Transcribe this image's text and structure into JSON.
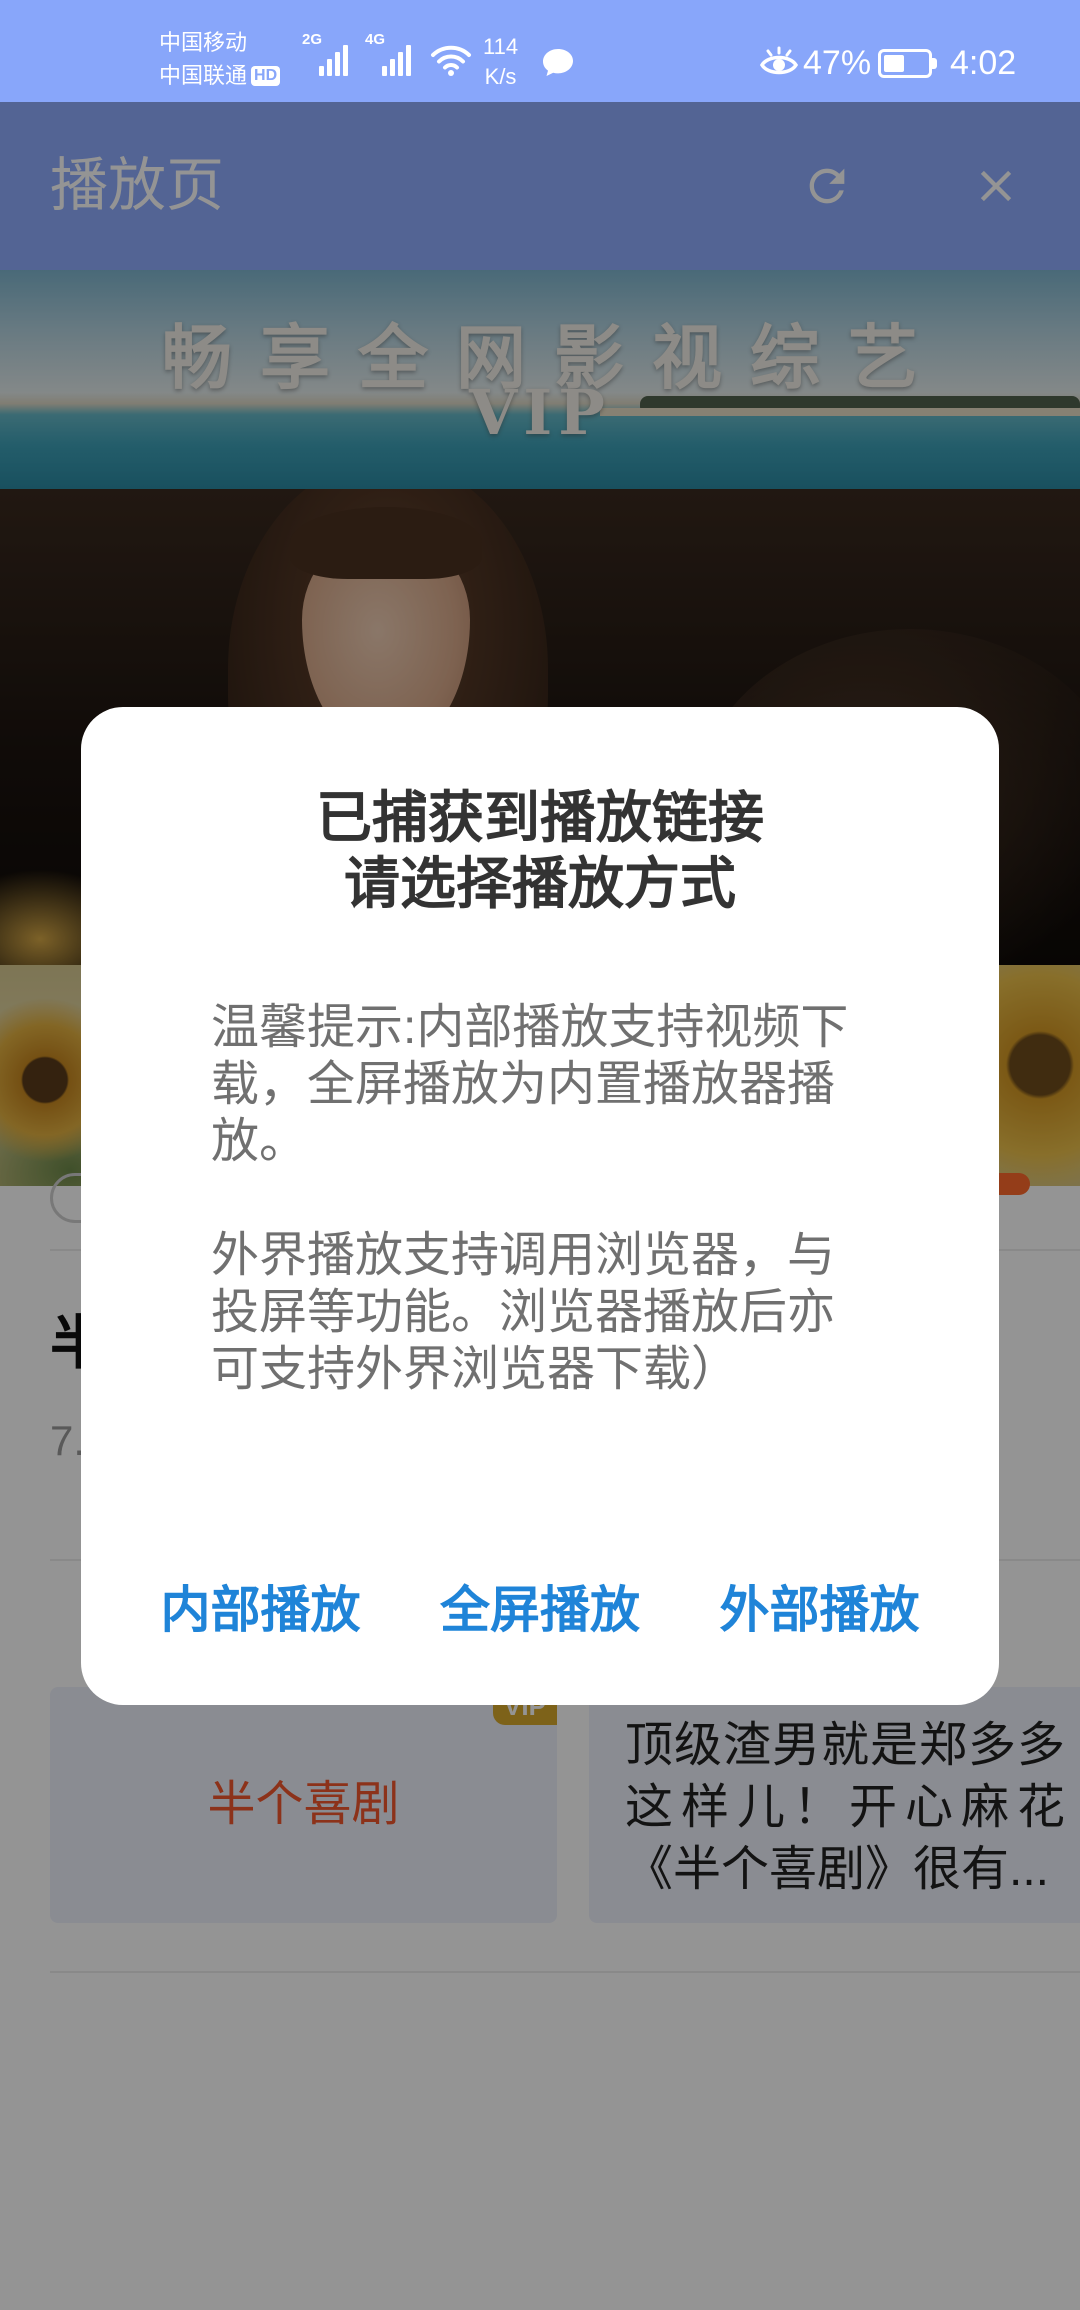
{
  "status_bar": {
    "carrier_primary": "中国移动",
    "carrier_secondary": "中国联通",
    "hd_badge": "HD",
    "network_1": "2G",
    "network_2": "4G",
    "speed_value": "114",
    "speed_unit": "K/s",
    "battery_percent": "47%",
    "battery_level": 0.47,
    "time": "4:02"
  },
  "app_bar": {
    "title": "播放页",
    "icons": {
      "refresh": "refresh-icon",
      "close": "close-icon"
    }
  },
  "banner": {
    "headline": "畅享全网影视综艺",
    "badge": "VIP"
  },
  "content": {
    "title_fragment": "半",
    "meta_fragment": "7.",
    "cards": [
      {
        "title": "半个喜剧",
        "badge": "VIP"
      },
      {
        "description": "顶级渣男就是郑多多这样儿！开心麻花《半个喜剧》很有..."
      }
    ]
  },
  "dialog": {
    "title_lines": [
      "已捕获到播放链接",
      "请选择播放方式"
    ],
    "message_paragraphs": [
      "温馨提示:内部播放支持视频下载，全屏播放为内置播放器播放。",
      "外界播放支持调用浏览器，与投屏等功能。浏览器播放后亦可支持外界浏览器下载）"
    ],
    "buttons": [
      {
        "label": "内部播放"
      },
      {
        "label": "全屏播放"
      },
      {
        "label": "外部播放"
      }
    ]
  },
  "colors": {
    "status_bar_bg": "#88a6fa",
    "app_bar_bg": "#8fadff",
    "accent": "#1f84d8",
    "dialog_title": "#333333",
    "dialog_text": "#707070",
    "card_title": "#f2562e",
    "vip_badge": "#d8a92c",
    "card_bg": "#eef2fb",
    "scrim": "rgba(0,0,0,0.42)"
  }
}
